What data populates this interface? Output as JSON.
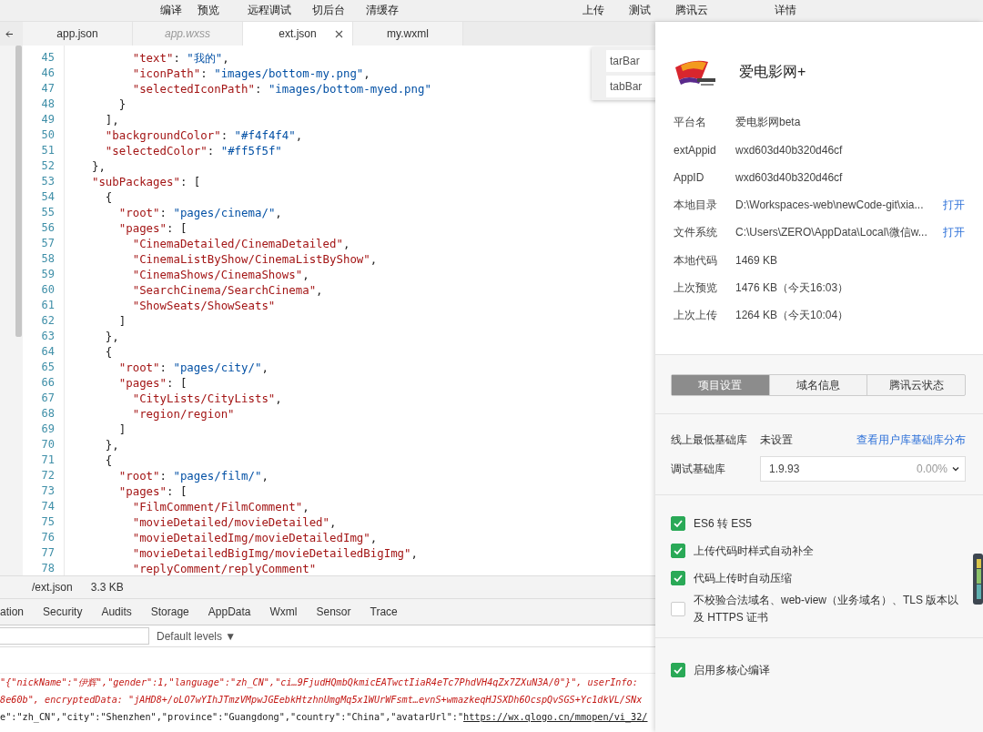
{
  "toolbar": {
    "left": [
      "编译",
      "预览",
      "远程调试",
      "切后台",
      "清缓存"
    ],
    "right": [
      "上传",
      "测试",
      "腾讯云",
      "详情"
    ]
  },
  "editor_tabs": [
    {
      "label": "app.json",
      "selected": false,
      "italic": false
    },
    {
      "label": "app.wxss",
      "selected": false,
      "italic": true
    },
    {
      "label": "ext.json",
      "selected": true,
      "italic": false
    },
    {
      "label": "my.wxml",
      "selected": false,
      "italic": false
    }
  ],
  "code_lines": [
    {
      "number": "45",
      "tokens": [
        {
          "kind": "property",
          "text": "        \"text\""
        },
        {
          "kind": "punct",
          "text": ": "
        },
        {
          "kind": "value",
          "text": "\"我的\""
        },
        {
          "kind": "punct",
          "text": ","
        }
      ]
    },
    {
      "number": "46",
      "tokens": [
        {
          "kind": "property",
          "text": "        \"iconPath\""
        },
        {
          "kind": "punct",
          "text": ": "
        },
        {
          "kind": "value",
          "text": "\"images/bottom-my.png\""
        },
        {
          "kind": "punct",
          "text": ","
        }
      ]
    },
    {
      "number": "47",
      "tokens": [
        {
          "kind": "property",
          "text": "        \"selectedIconPath\""
        },
        {
          "kind": "punct",
          "text": ": "
        },
        {
          "kind": "value",
          "text": "\"images/bottom-myed.png\""
        }
      ]
    },
    {
      "number": "48",
      "tokens": [
        {
          "kind": "punct",
          "text": "      }"
        }
      ]
    },
    {
      "number": "49",
      "tokens": [
        {
          "kind": "punct",
          "text": "    ],"
        }
      ]
    },
    {
      "number": "50",
      "tokens": [
        {
          "kind": "property",
          "text": "    \"backgroundColor\""
        },
        {
          "kind": "punct",
          "text": ": "
        },
        {
          "kind": "value",
          "text": "\"#f4f4f4\""
        },
        {
          "kind": "punct",
          "text": ","
        }
      ]
    },
    {
      "number": "51",
      "tokens": [
        {
          "kind": "property",
          "text": "    \"selectedColor\""
        },
        {
          "kind": "punct",
          "text": ": "
        },
        {
          "kind": "value",
          "text": "\"#ff5f5f\""
        }
      ]
    },
    {
      "number": "52",
      "tokens": [
        {
          "kind": "punct",
          "text": "  },"
        }
      ]
    },
    {
      "number": "53",
      "tokens": [
        {
          "kind": "property",
          "text": "  \"subPackages\""
        },
        {
          "kind": "punct",
          "text": ": ["
        }
      ]
    },
    {
      "number": "54",
      "tokens": [
        {
          "kind": "punct",
          "text": "    {"
        }
      ]
    },
    {
      "number": "55",
      "tokens": [
        {
          "kind": "property",
          "text": "      \"root\""
        },
        {
          "kind": "punct",
          "text": ": "
        },
        {
          "kind": "value",
          "text": "\"pages/cinema/\""
        },
        {
          "kind": "punct",
          "text": ","
        }
      ]
    },
    {
      "number": "56",
      "tokens": [
        {
          "kind": "property",
          "text": "      \"pages\""
        },
        {
          "kind": "punct",
          "text": ": ["
        }
      ]
    },
    {
      "number": "57",
      "tokens": [
        {
          "kind": "item",
          "text": "        \"CinemaDetailed/CinemaDetailed\""
        },
        {
          "kind": "punct",
          "text": ","
        }
      ]
    },
    {
      "number": "58",
      "tokens": [
        {
          "kind": "item",
          "text": "        \"CinemaListByShow/CinemaListByShow\""
        },
        {
          "kind": "punct",
          "text": ","
        }
      ]
    },
    {
      "number": "59",
      "tokens": [
        {
          "kind": "item",
          "text": "        \"CinemaShows/CinemaShows\""
        },
        {
          "kind": "punct",
          "text": ","
        }
      ]
    },
    {
      "number": "60",
      "tokens": [
        {
          "kind": "item",
          "text": "        \"SearchCinema/SearchCinema\""
        },
        {
          "kind": "punct",
          "text": ","
        }
      ]
    },
    {
      "number": "61",
      "tokens": [
        {
          "kind": "item",
          "text": "        \"ShowSeats/ShowSeats\""
        }
      ]
    },
    {
      "number": "62",
      "tokens": [
        {
          "kind": "punct",
          "text": "      ]"
        }
      ]
    },
    {
      "number": "63",
      "tokens": [
        {
          "kind": "punct",
          "text": "    },"
        }
      ]
    },
    {
      "number": "64",
      "tokens": [
        {
          "kind": "punct",
          "text": "    {"
        }
      ]
    },
    {
      "number": "65",
      "tokens": [
        {
          "kind": "property",
          "text": "      \"root\""
        },
        {
          "kind": "punct",
          "text": ": "
        },
        {
          "kind": "value",
          "text": "\"pages/city/\""
        },
        {
          "kind": "punct",
          "text": ","
        }
      ]
    },
    {
      "number": "66",
      "tokens": [
        {
          "kind": "property",
          "text": "      \"pages\""
        },
        {
          "kind": "punct",
          "text": ": ["
        }
      ]
    },
    {
      "number": "67",
      "tokens": [
        {
          "kind": "item",
          "text": "        \"CityLists/CityLists\""
        },
        {
          "kind": "punct",
          "text": ","
        }
      ]
    },
    {
      "number": "68",
      "tokens": [
        {
          "kind": "item",
          "text": "        \"region/region\""
        }
      ]
    },
    {
      "number": "69",
      "tokens": [
        {
          "kind": "punct",
          "text": "      ]"
        }
      ]
    },
    {
      "number": "70",
      "tokens": [
        {
          "kind": "punct",
          "text": "    },"
        }
      ]
    },
    {
      "number": "71",
      "tokens": [
        {
          "kind": "punct",
          "text": "    {"
        }
      ]
    },
    {
      "number": "72",
      "tokens": [
        {
          "kind": "property",
          "text": "      \"root\""
        },
        {
          "kind": "punct",
          "text": ": "
        },
        {
          "kind": "value",
          "text": "\"pages/film/\""
        },
        {
          "kind": "punct",
          "text": ","
        }
      ]
    },
    {
      "number": "73",
      "tokens": [
        {
          "kind": "property",
          "text": "      \"pages\""
        },
        {
          "kind": "punct",
          "text": ": ["
        }
      ]
    },
    {
      "number": "74",
      "tokens": [
        {
          "kind": "item",
          "text": "        \"FilmComment/FilmComment\""
        },
        {
          "kind": "punct",
          "text": ","
        }
      ]
    },
    {
      "number": "75",
      "tokens": [
        {
          "kind": "item",
          "text": "        \"movieDetailed/movieDetailed\""
        },
        {
          "kind": "punct",
          "text": ","
        }
      ]
    },
    {
      "number": "76",
      "tokens": [
        {
          "kind": "item",
          "text": "        \"movieDetailedImg/movieDetailedImg\""
        },
        {
          "kind": "punct",
          "text": ","
        }
      ]
    },
    {
      "number": "77",
      "tokens": [
        {
          "kind": "item",
          "text": "        \"movieDetailedBigImg/movieDetailedBigImg\""
        },
        {
          "kind": "punct",
          "text": ","
        }
      ]
    },
    {
      "number": "78",
      "tokens": [
        {
          "kind": "item",
          "text": "        \"replyComment/replyComment\""
        }
      ]
    }
  ],
  "autocomplete": [
    {
      "label": "tarBar"
    },
    {
      "label": "tabBar"
    }
  ],
  "status_bar": {
    "file": "/ext.json",
    "size": "3.3 KB"
  },
  "devtools_tabs": [
    {
      "label": "ation",
      "selected": false
    },
    {
      "label": "Security",
      "selected": false
    },
    {
      "label": "Audits",
      "selected": false
    },
    {
      "label": "Storage",
      "selected": false
    },
    {
      "label": "AppData",
      "selected": false
    },
    {
      "label": "Wxml",
      "selected": false
    },
    {
      "label": "Sensor",
      "selected": false
    },
    {
      "label": "Trace",
      "selected": false
    }
  ],
  "console_filter": {
    "levels": "Default levels ▼"
  },
  "console_lines": [
    {
      "kind": "error",
      "text": "\"{\"nickName\":\"伊辉\",\"gender\":1,\"language\":\"zh_CN\",\"ci…9FjudHQmbQkmicEATwctIiaR4eTc7PhdVH4qZx7ZXuN3A/0\"}\", userInfo:"
    },
    {
      "kind": "error",
      "text": "8e60b\", encryptedData: \"jAHD8+/oLO7wYIhJTmzVMpwJGEebkHtzhnUmgMq5x1WUrWFsmt…evnS+wmazkeqHJSXDh6OcspQvSGS+Yc1dkVL/SNx"
    },
    {
      "kind": "log",
      "text": "e\":\"zh_CN\",\"city\":\"Shenzhen\",\"province\":\"Guangdong\",\"country\":\"China\",\"avatarUrl\":\"",
      "link": "https://wx.qlogo.cn/mmopen/vi_32/"
    }
  ],
  "details": {
    "app_name": "爱电影网+",
    "info": [
      {
        "label": "平台名",
        "value": "爱电影网beta"
      },
      {
        "label": "extAppid",
        "value": "wxd603d40b320d46cf"
      },
      {
        "label": "AppID",
        "value": "wxd603d40b320d46cf"
      },
      {
        "label": "本地目录",
        "value": "D:\\Workspaces-web\\newCode-git\\xia...",
        "link": "打开"
      },
      {
        "label": "文件系统",
        "value": "C:\\Users\\ZERO\\AppData\\Local\\微信w...",
        "link": "打开"
      },
      {
        "label": "本地代码",
        "value": "1469 KB"
      },
      {
        "label": "上次预览",
        "value": "1476 KB（今天16:03）"
      },
      {
        "label": "上次上传",
        "value": "1264 KB（今天10:04）"
      }
    ],
    "segments": [
      {
        "label": "项目设置",
        "selected": true
      },
      {
        "label": "域名信息",
        "selected": false
      },
      {
        "label": "腾讯云状态",
        "selected": false
      }
    ],
    "min_lib": {
      "label": "线上最低基础库",
      "value": "未设置",
      "link": "查看用户库基础库分布"
    },
    "debug_lib": {
      "label": "调试基础库",
      "version": "1.9.93",
      "share": "0.00%"
    },
    "options": [
      {
        "label": "ES6 转 ES5",
        "checked": true
      },
      {
        "label": "上传代码时样式自动补全",
        "checked": true
      },
      {
        "label": "代码上传时自动压缩",
        "checked": true
      },
      {
        "label": "不校验合法域名、web-view（业务域名）、TLS 版本以及 HTTPS 证书",
        "checked": false
      }
    ],
    "options_2": [
      {
        "label": "启用多核心编译",
        "checked": true
      }
    ]
  }
}
